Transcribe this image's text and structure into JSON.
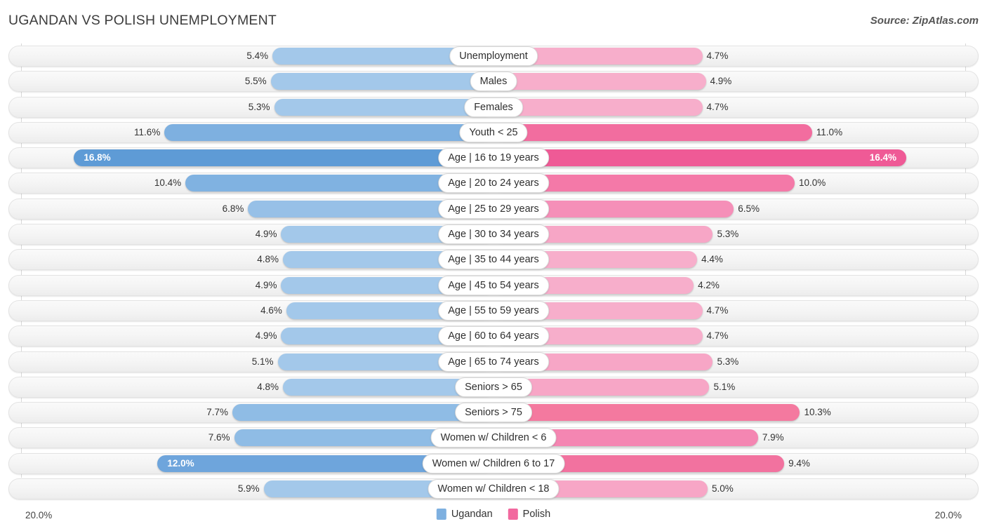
{
  "header": {
    "title": "UGANDAN VS POLISH UNEMPLOYMENT",
    "source": "Source: ZipAtlas.com"
  },
  "axis": {
    "left_label": "20.0%",
    "right_label": "20.0%",
    "max": 20.0
  },
  "legend": {
    "items": [
      {
        "label": "Ugandan",
        "color": "#7eb0e0"
      },
      {
        "label": "Polish",
        "color": "#f2699f"
      }
    ]
  },
  "colors": {
    "ugandan_light": "#a3c8ea",
    "ugandan_mid": "#87b7e4",
    "ugandan_dark": "#5e9bd6",
    "polish_light": "#f7aecb",
    "polish_mid": "#f488b4",
    "polish_dark": "#f2699f",
    "polish_darkest": "#ef5f9a",
    "track": "#f4f4f4",
    "gridline": "#d8d8d8"
  },
  "chart_data": {
    "type": "bar",
    "subtype": "diverging-bidirectional",
    "title": "UGANDAN VS POLISH UNEMPLOYMENT",
    "xlabel": "",
    "ylabel": "",
    "unit": "%",
    "axis_max": 20.0,
    "axis_left_tick": "20.0%",
    "axis_right_tick": "20.0%",
    "grid": false,
    "legend_position": "bottom-center",
    "series": [
      {
        "name": "Ugandan",
        "color": "#7eb0e0",
        "side": "left",
        "values": [
          5.4,
          5.5,
          5.3,
          11.6,
          16.8,
          10.4,
          6.8,
          4.9,
          4.8,
          4.9,
          4.6,
          4.9,
          5.1,
          4.8,
          7.7,
          7.6,
          12.0,
          5.9
        ]
      },
      {
        "name": "Polish",
        "color": "#f2699f",
        "side": "right",
        "values": [
          4.7,
          4.9,
          4.7,
          11.0,
          16.4,
          10.0,
          6.5,
          5.3,
          4.4,
          4.2,
          4.7,
          4.7,
          5.3,
          5.1,
          10.3,
          7.9,
          9.4,
          5.0
        ]
      }
    ],
    "categories": [
      "Unemployment",
      "Males",
      "Females",
      "Youth < 25",
      "Age | 16 to 19 years",
      "Age | 20 to 24 years",
      "Age | 25 to 29 years",
      "Age | 30 to 34 years",
      "Age | 35 to 44 years",
      "Age | 45 to 54 years",
      "Age | 55 to 59 years",
      "Age | 60 to 64 years",
      "Age | 65 to 74 years",
      "Seniors > 65",
      "Seniors > 75",
      "Women w/ Children < 6",
      "Women w/ Children 6 to 17",
      "Women w/ Children < 18"
    ]
  },
  "rows": [
    {
      "label": "Unemployment",
      "left_value": 5.4,
      "left_text": "5.4%",
      "right_value": 4.7,
      "right_text": "4.7%",
      "left_color": "#a3c8ea",
      "right_color": "#f7aecb",
      "left_inside": false,
      "right_inside": false
    },
    {
      "label": "Males",
      "left_value": 5.5,
      "left_text": "5.5%",
      "right_value": 4.9,
      "right_text": "4.9%",
      "left_color": "#a3c8ea",
      "right_color": "#f7aecb",
      "left_inside": false,
      "right_inside": false
    },
    {
      "label": "Females",
      "left_value": 5.3,
      "left_text": "5.3%",
      "right_value": 4.7,
      "right_text": "4.7%",
      "left_color": "#a3c8ea",
      "right_color": "#f7aecb",
      "left_inside": false,
      "right_inside": false
    },
    {
      "label": "Youth < 25",
      "left_value": 11.6,
      "left_text": "11.6%",
      "right_value": 11.0,
      "right_text": "11.0%",
      "left_color": "#7eb0e0",
      "right_color": "#f26d9f",
      "left_inside": false,
      "right_inside": false
    },
    {
      "label": "Age | 16 to 19 years",
      "left_value": 16.8,
      "left_text": "16.8%",
      "right_value": 16.4,
      "right_text": "16.4%",
      "left_color": "#5e9bd6",
      "right_color": "#ef5a96",
      "left_inside": true,
      "right_inside": true
    },
    {
      "label": "Age | 20 to 24 years",
      "left_value": 10.4,
      "left_text": "10.4%",
      "right_value": 10.0,
      "right_text": "10.0%",
      "left_color": "#80b2e1",
      "right_color": "#f479a8",
      "left_inside": false,
      "right_inside": false
    },
    {
      "label": "Age | 25 to 29 years",
      "left_value": 6.8,
      "left_text": "6.8%",
      "right_value": 6.5,
      "right_text": "6.5%",
      "left_color": "#97c0e7",
      "right_color": "#f58fb8",
      "left_inside": false,
      "right_inside": false
    },
    {
      "label": "Age | 30 to 34 years",
      "left_value": 4.9,
      "left_text": "4.9%",
      "right_value": 5.3,
      "right_text": "5.3%",
      "left_color": "#a3c8ea",
      "right_color": "#f7a6c6",
      "left_inside": false,
      "right_inside": false
    },
    {
      "label": "Age | 35 to 44 years",
      "left_value": 4.8,
      "left_text": "4.8%",
      "right_value": 4.4,
      "right_text": "4.4%",
      "left_color": "#a3c8ea",
      "right_color": "#f7aecb",
      "left_inside": false,
      "right_inside": false
    },
    {
      "label": "Age | 45 to 54 years",
      "left_value": 4.9,
      "left_text": "4.9%",
      "right_value": 4.2,
      "right_text": "4.2%",
      "left_color": "#a3c8ea",
      "right_color": "#f7aecb",
      "left_inside": false,
      "right_inside": false
    },
    {
      "label": "Age | 55 to 59 years",
      "left_value": 4.6,
      "left_text": "4.6%",
      "right_value": 4.7,
      "right_text": "4.7%",
      "left_color": "#a3c8ea",
      "right_color": "#f7aecb",
      "left_inside": false,
      "right_inside": false
    },
    {
      "label": "Age | 60 to 64 years",
      "left_value": 4.9,
      "left_text": "4.9%",
      "right_value": 4.7,
      "right_text": "4.7%",
      "left_color": "#a3c8ea",
      "right_color": "#f7aecb",
      "left_inside": false,
      "right_inside": false
    },
    {
      "label": "Age | 65 to 74 years",
      "left_value": 5.1,
      "left_text": "5.1%",
      "right_value": 5.3,
      "right_text": "5.3%",
      "left_color": "#a3c8ea",
      "right_color": "#f7a6c6",
      "left_inside": false,
      "right_inside": false
    },
    {
      "label": "Seniors > 65",
      "left_value": 4.8,
      "left_text": "4.8%",
      "right_value": 5.1,
      "right_text": "5.1%",
      "left_color": "#a3c8ea",
      "right_color": "#f7a6c6",
      "left_inside": false,
      "right_inside": false
    },
    {
      "label": "Seniors > 75",
      "left_value": 7.7,
      "left_text": "7.7%",
      "right_value": 10.3,
      "right_text": "10.3%",
      "left_color": "#8fbce5",
      "right_color": "#f4799f",
      "left_inside": false,
      "right_inside": false
    },
    {
      "label": "Women w/ Children < 6",
      "left_value": 7.6,
      "left_text": "7.6%",
      "right_value": 7.9,
      "right_text": "7.9%",
      "left_color": "#8fbce5",
      "right_color": "#f486b2",
      "left_inside": false,
      "right_inside": false
    },
    {
      "label": "Women w/ Children 6 to 17",
      "left_value": 12.0,
      "left_text": "12.0%",
      "right_value": 9.4,
      "right_text": "9.4%",
      "left_color": "#6ea5dc",
      "right_color": "#f2729f",
      "left_inside": true,
      "right_inside": false
    },
    {
      "label": "Women w/ Children < 18",
      "left_value": 5.9,
      "left_text": "5.9%",
      "right_value": 5.0,
      "right_text": "5.0%",
      "left_color": "#a3c8ea",
      "right_color": "#f7a6c6",
      "left_inside": false,
      "right_inside": false
    }
  ]
}
